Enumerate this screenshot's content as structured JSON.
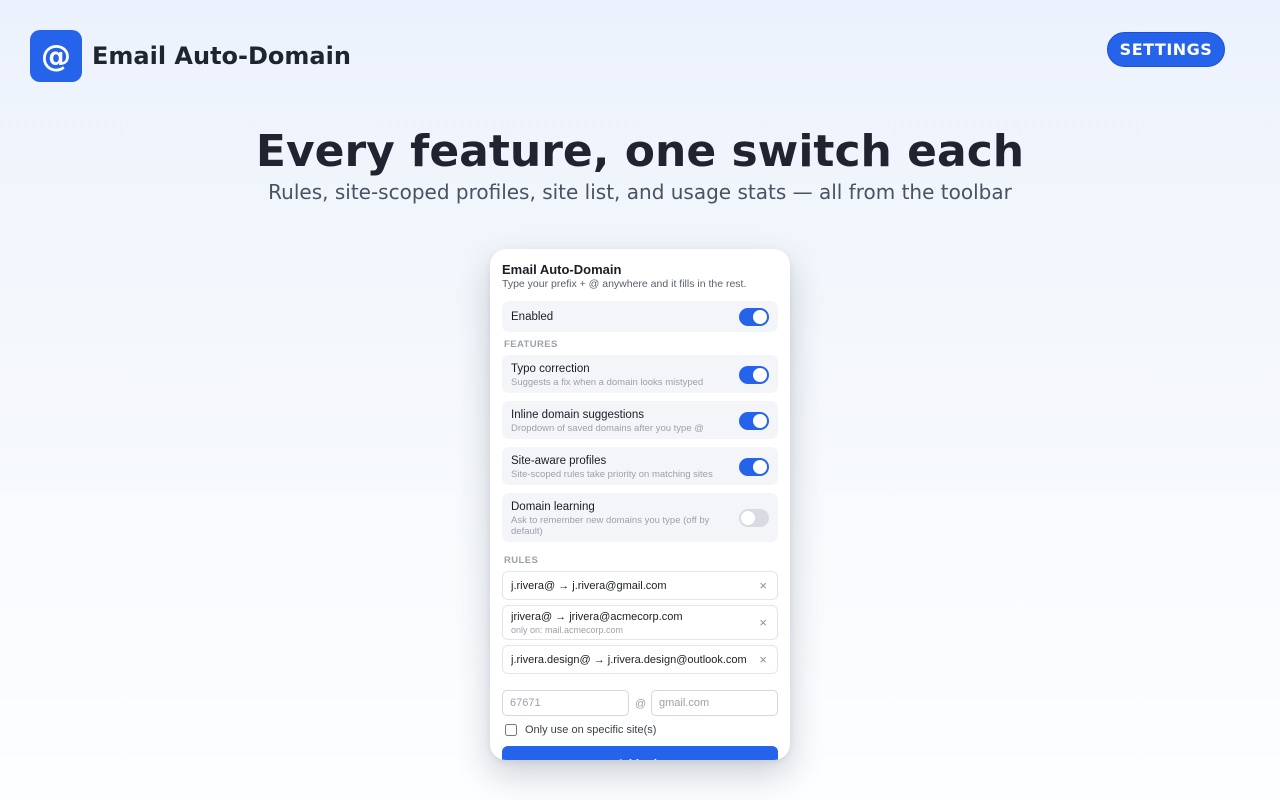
{
  "header": {
    "logo_glyph": "@",
    "app_name": "Email Auto-Domain",
    "settings_label": "SETTINGS"
  },
  "hero": {
    "title": "Every feature, one switch each",
    "subtitle": "Rules, site-scoped profiles, site list, and usage stats — all from the toolbar"
  },
  "popup": {
    "title": "Email Auto-Domain",
    "subtitle": "Type your prefix + @ anywhere and it fills in the rest.",
    "enabled": {
      "label": "Enabled",
      "on": true
    },
    "features_heading": "FEATURES",
    "features": [
      {
        "label": "Typo correction",
        "desc": "Suggests a fix when a domain looks mistyped",
        "on": true
      },
      {
        "label": "Inline domain suggestions",
        "desc": "Dropdown of saved domains after you type @",
        "on": true
      },
      {
        "label": "Site-aware profiles",
        "desc": "Site-scoped rules take priority on matching sites",
        "on": true
      },
      {
        "label": "Domain learning",
        "desc": "Ask to remember new domains you type (off by default)",
        "on": false
      }
    ],
    "rules_heading": "RULES",
    "rules": [
      {
        "text": "j.rivera@ → j.rivera@gmail.com",
        "scope": ""
      },
      {
        "text": "jrivera@ → jrivera@acmecorp.com",
        "scope": "only on: mail.acmecorp.com"
      },
      {
        "text": "j.rivera.design@ → j.rivera.design@outlook.com",
        "scope": ""
      }
    ],
    "remove_glyph": "×",
    "new_rule": {
      "prefix_placeholder": "67671",
      "at_symbol": "@",
      "domain_placeholder": "gmail.com",
      "site_checkbox_label": "Only use on specific site(s)",
      "site_checkbox_checked": false,
      "add_label": "Add rule"
    }
  },
  "colors": {
    "accent": "#2563eb",
    "toggle_off": "#d8dbe1",
    "card_bg": "#f4f5f8"
  }
}
